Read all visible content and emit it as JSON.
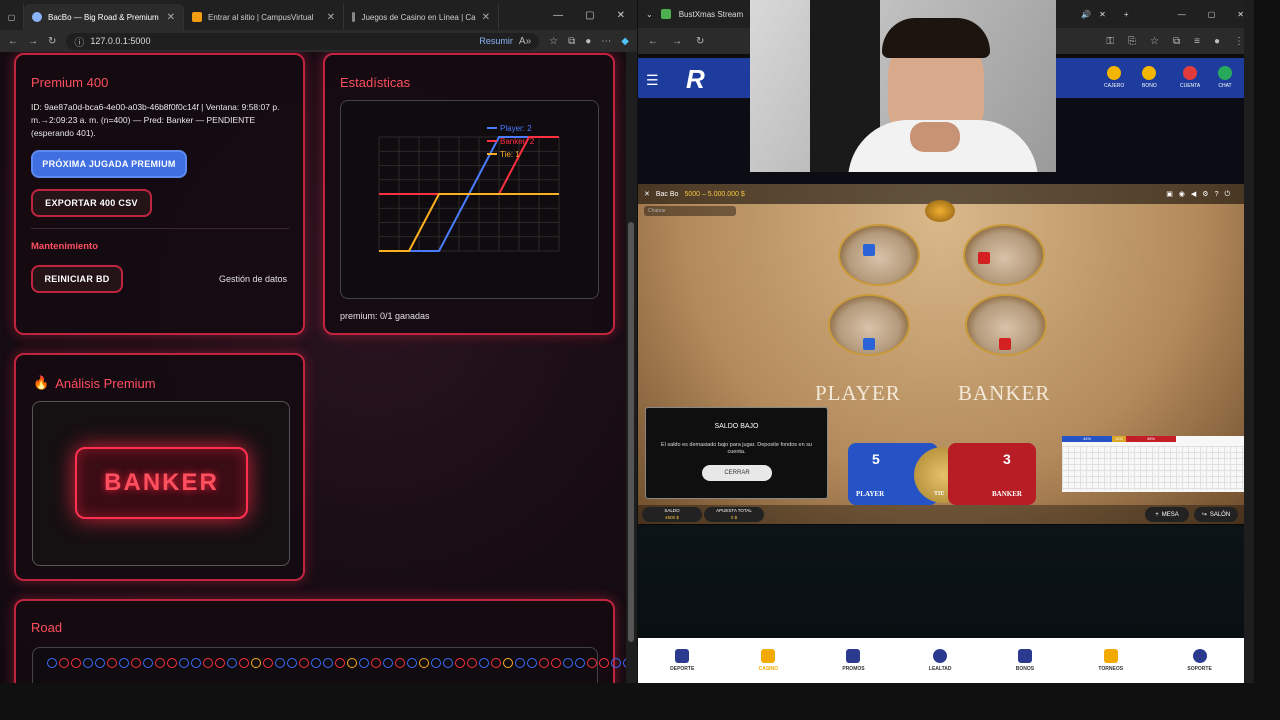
{
  "left_browser": {
    "tabs": [
      {
        "title": "BacBo — Big Road & Premium"
      },
      {
        "title": "Entrar al sitio | CampusVirtual"
      },
      {
        "title": "Juegos de Casino en Línea | Ca"
      }
    ],
    "url": "127.0.0.1:5000",
    "resumir": "Resumir"
  },
  "premium": {
    "title": "Premium 400",
    "meta": "ID: 9ae87a0d-bca6-4e00-a03b-46b8f0f0c14f | Ventana: 9:58:07 p. m.→2:09:23 a. m. (n=400) — Pred: Banker — PENDIENTE (esperando 401).",
    "next_button": "PRÓXIMA JUGADA PREMIUM",
    "export_button": "EXPORTAR 400 CSV",
    "maintenance_title": "Mantenimiento",
    "reset_button": "REINICIAR BD",
    "data_mgmt": "Gestión de datos"
  },
  "stats": {
    "title": "Estadísticas",
    "footer": "premium: 0/1 ganadas"
  },
  "chart_data": {
    "type": "line",
    "x": [
      0,
      1,
      2,
      3,
      4,
      5,
      6
    ],
    "series": [
      {
        "name": "Player: 2",
        "values": [
          0,
          0,
          0,
          1,
          2,
          2,
          2
        ],
        "color": "#4a7cff"
      },
      {
        "name": "Banker: 2",
        "values": [
          1,
          1,
          1,
          1,
          1,
          2,
          2
        ],
        "color": "#ff3040"
      },
      {
        "name": "Tie: 1",
        "values": [
          0,
          0,
          1,
          1,
          1,
          1,
          1
        ],
        "color": "#ffb020"
      }
    ],
    "ylim": [
      0,
      2
    ],
    "grid": true,
    "legend": "top-right"
  },
  "analysis": {
    "title": "Análisis Premium",
    "prediction": "BANKER"
  },
  "road": {
    "title": "Road",
    "row1": [
      "b",
      "r",
      "r",
      "b",
      "b",
      "r",
      "b",
      "r",
      "b",
      "r",
      "r",
      "b",
      "b",
      "r",
      "r",
      "b",
      "r",
      "t",
      "r",
      "b",
      "b",
      "r",
      "b",
      "b",
      "r",
      "t",
      "b",
      "r",
      "b",
      "r",
      "b",
      "t",
      "b",
      "b",
      "r",
      "r",
      "b",
      "r",
      "t",
      "b",
      "b",
      "r",
      "r",
      "b",
      "b",
      "r",
      "r",
      "b",
      "b",
      "r"
    ]
  },
  "right_browser": {
    "tab_title": "BustXmas Stream",
    "header": {
      "cajero": "CAJERO",
      "bono": "BONO",
      "cuenta": "CUENTA",
      "chat": "CHAT"
    },
    "game": {
      "title": "Bac Bo",
      "limits": "5000 – 5.000.000 $",
      "chat_placeholder": "Chatear",
      "player_label": "PLAYER",
      "banker_label": "BANKER",
      "tie_label": "TIE",
      "player_score": "5",
      "banker_score": "3",
      "modal_title": "SALDO BAJO",
      "modal_body": "El saldo es demasiado bajo para jugar. Deposite fondos en su cuenta.",
      "modal_button": "CERRAR",
      "saldo_label": "SALDO",
      "saldo_value": "4500 $",
      "apuesta_label": "APUESTA TOTAL",
      "apuesta_value": "0 $",
      "mesa_button": "MESA",
      "salon_button": "SALÓN",
      "stats_blue": "44%",
      "stats_tie": "11%",
      "stats_red": "45%"
    },
    "footer": [
      "DEPORTE",
      "CASINO",
      "PROMOS",
      "LEALTAD",
      "BONOS",
      "TORNEOS",
      "SOPORTE"
    ]
  }
}
